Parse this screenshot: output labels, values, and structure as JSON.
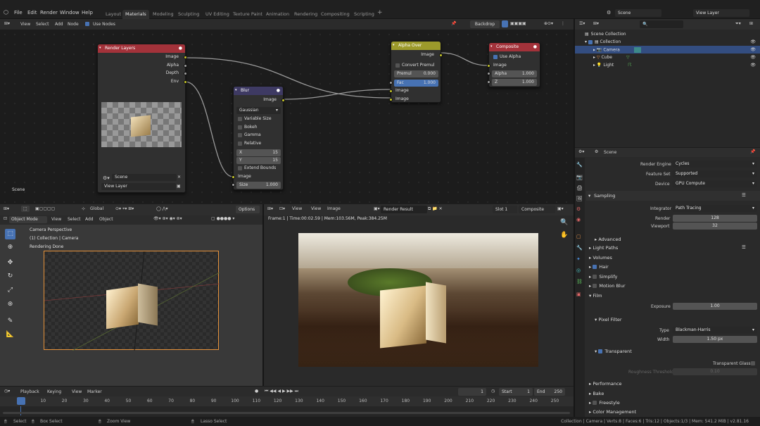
{
  "menubar": {
    "file": "File",
    "edit": "Edit",
    "render": "Render",
    "window": "Window",
    "help": "Help"
  },
  "workspaces": [
    "Layout",
    "Materials",
    "Modeling",
    "Sculpting",
    "UV Editing",
    "Texture Paint",
    "Animation",
    "Rendering",
    "Compositing",
    "Scripting"
  ],
  "active_workspace": "Materials",
  "scene_field": "Scene",
  "viewlayer_field": "View Layer",
  "node_header": {
    "view": "View",
    "select": "Select",
    "add": "Add",
    "node": "Node",
    "use_nodes": "Use Nodes",
    "backdrop": "Backdrop"
  },
  "scene_label": "Scene",
  "nodes": {
    "render_layers": {
      "title": "Render Layers",
      "outputs": [
        "Image",
        "Alpha",
        "Depth",
        "Env"
      ],
      "scene": "Scene",
      "view_layer": "View Layer"
    },
    "blur": {
      "title": "Blur",
      "output": "Image",
      "filter": "Gaussian",
      "variable_size": "Variable Size",
      "bokeh": "Bokeh",
      "gamma": "Gamma",
      "relative": "Relative",
      "x_label": "X",
      "x_val": "15",
      "y_label": "Y",
      "y_val": "15",
      "extend_bounds": "Extend Bounds",
      "input_image": "Image",
      "size_label": "Size",
      "size_val": "1.000"
    },
    "alpha_over": {
      "title": "Alpha Over",
      "output": "Image",
      "convert_premul": "Convert Premul",
      "premul_label": "Premul",
      "premul_val": "0.000",
      "fac_label": "Fac",
      "fac_val": "1.000",
      "image1": "Image",
      "image2": "Image"
    },
    "composite": {
      "title": "Composite",
      "use_alpha": "Use Alpha",
      "image": "Image",
      "alpha_label": "Alpha",
      "alpha_val": "1.000",
      "z_label": "Z",
      "z_val": "1.000"
    }
  },
  "viewport": {
    "mode": "Object Mode",
    "view": "View",
    "select": "Select",
    "add": "Add",
    "object": "Object",
    "orientation": "Global",
    "options": "Options",
    "info1": "Camera Perspective",
    "info2": "(1) Collection | Camera",
    "info3": "Rendering Done"
  },
  "image_editor": {
    "view": "View",
    "view2": "View",
    "image": "Image",
    "result": "Render Result",
    "slot": "Slot 1",
    "pass": "Composite",
    "info": "Frame:1 | Time:00:02.59 | Mem:103.56M, Peak:384.25M"
  },
  "timeline": {
    "playback": "Playback",
    "keying": "Keying",
    "view": "View",
    "marker": "Marker",
    "current_frame": "1",
    "start_label": "Start",
    "start": "1",
    "end_label": "End",
    "end": "250",
    "ticks": [
      "1",
      "10",
      "20",
      "30",
      "40",
      "50",
      "60",
      "70",
      "80",
      "90",
      "100",
      "110",
      "120",
      "130",
      "140",
      "150",
      "160",
      "170",
      "180",
      "190",
      "200",
      "210",
      "220",
      "230",
      "240",
      "250"
    ]
  },
  "status": {
    "select": "Select",
    "box_select": "Box Select",
    "zoom_view": "Zoom View",
    "lasso_select": "Lasso Select",
    "stats": "Collection | Camera | Verts:8 | Faces:6 | Tris:12 | Objects:1/3 | Mem: 541.2 MiB | v2.81.16"
  },
  "outliner": {
    "root": "Scene Collection",
    "collection": "Collection",
    "items": [
      "Camera",
      "Cube",
      "Light"
    ]
  },
  "properties": {
    "scene_label": "Scene",
    "render_engine_label": "Render Engine",
    "render_engine": "Cycles",
    "feature_set_label": "Feature Set",
    "feature_set": "Supported",
    "device_label": "Device",
    "device": "GPU Compute",
    "sampling": "Sampling",
    "integrator_label": "Integrator",
    "integrator": "Path Tracing",
    "render_label": "Render",
    "render_val": "128",
    "viewport_label": "Viewport",
    "viewport_val": "32",
    "advanced": "Advanced",
    "light_paths": "Light Paths",
    "volumes": "Volumes",
    "hair": "Hair",
    "simplify": "Simplify",
    "motion_blur": "Motion Blur",
    "film": "Film",
    "exposure_label": "Exposure",
    "exposure": "1.00",
    "pixel_filter": "Pixel Filter",
    "type_label": "Type",
    "type": "Blackman-Harris",
    "width_label": "Width",
    "width": "1.50 px",
    "transparent": "Transparent",
    "transparent_glass": "Transparent Glass",
    "roughness_label": "Roughness Threshold",
    "roughness": "0.10",
    "performance": "Performance",
    "bake": "Bake",
    "freestyle": "Freestyle",
    "color_management": "Color Management"
  },
  "colors": {
    "accent": "#4772b3",
    "render_layers_head": "#a3323a",
    "blur_head": "#3e3a63",
    "alpha_over_head": "#9c9a2b",
    "composite_head": "#a3323a"
  }
}
